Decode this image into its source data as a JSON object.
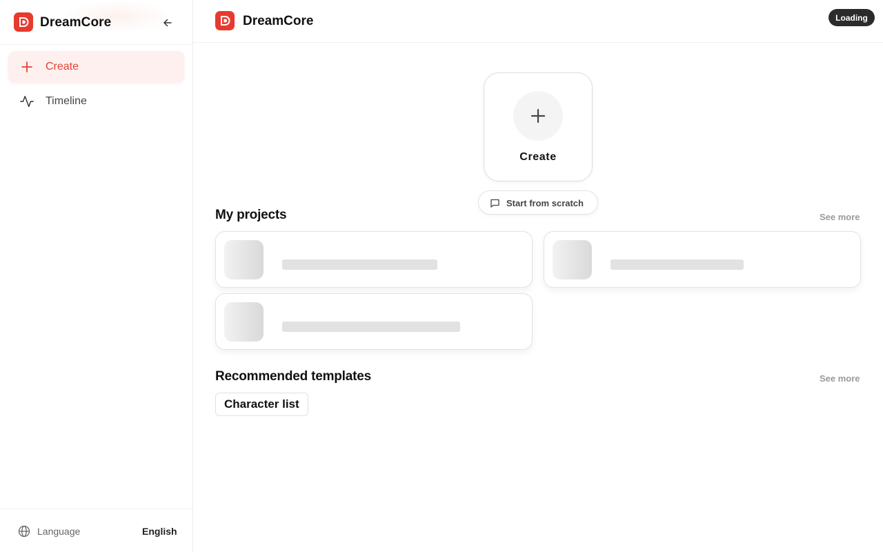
{
  "app": {
    "brand": "DreamCore",
    "accent": "#e8392f"
  },
  "sidebar": {
    "brand": "DreamCore",
    "collapse_icon": "arrow-left-icon",
    "items": [
      {
        "label": "Create",
        "icon": "plus-icon",
        "active": true
      },
      {
        "label": "Timeline",
        "icon": "activity-icon",
        "active": false
      }
    ],
    "footer": {
      "language_label": "Language",
      "language_value": "English",
      "icon": "globe-icon"
    }
  },
  "topbar": {
    "brand": "DreamCore",
    "status_badge": "Loading"
  },
  "create_card": {
    "label": "Create",
    "icon": "plus-icon"
  },
  "scratch_button": {
    "label": "Start from scratch",
    "icon": "message-square-icon"
  },
  "projects": {
    "title": "My projects",
    "see_more": "See more"
  },
  "templates": {
    "title": "Recommended templates",
    "see_more": "See more",
    "items": [
      "Character list"
    ]
  }
}
